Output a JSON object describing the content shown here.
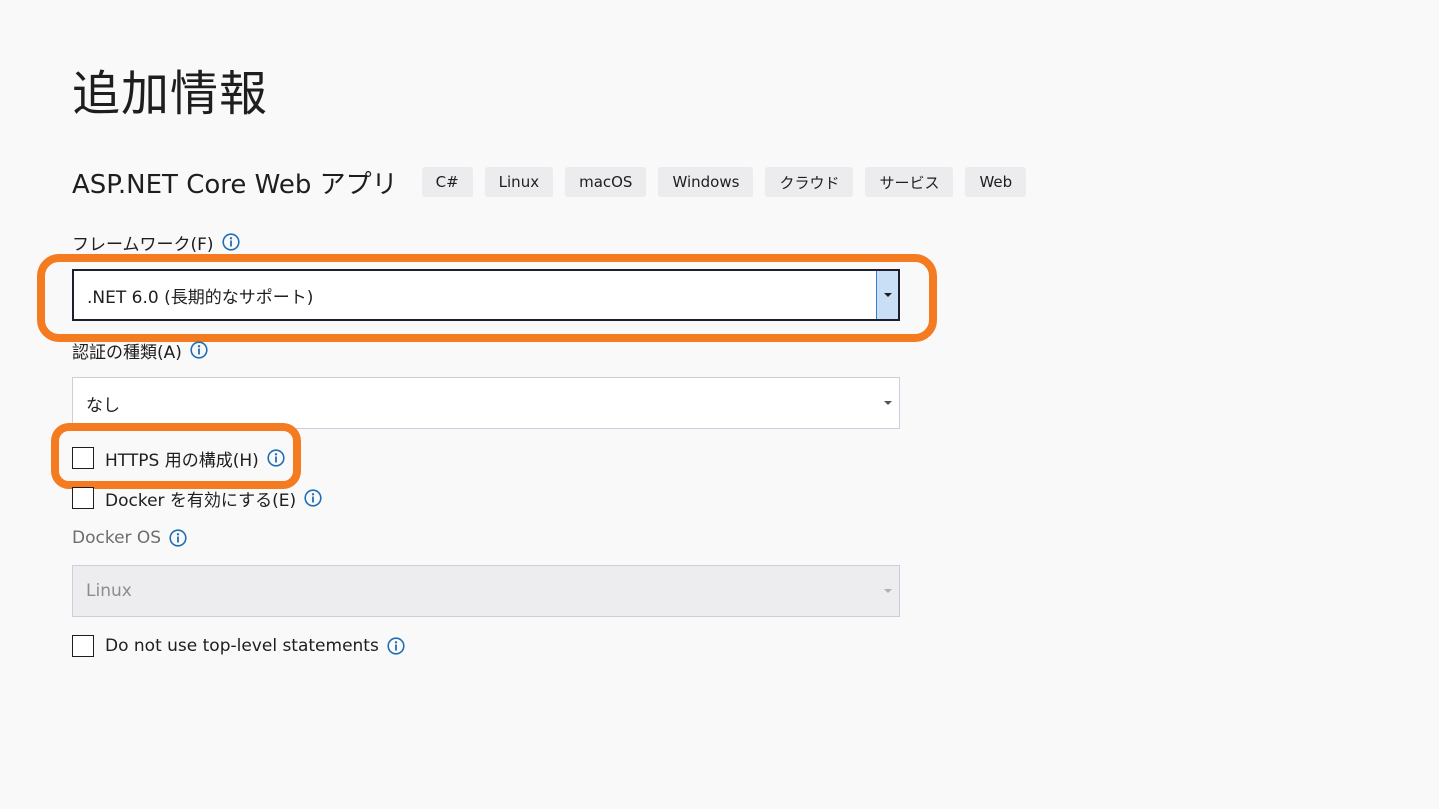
{
  "page": {
    "title": "追加情報"
  },
  "template": {
    "name": "ASP.NET Core Web アプリ",
    "tags": [
      "C#",
      "Linux",
      "macOS",
      "Windows",
      "クラウド",
      "サービス",
      "Web"
    ]
  },
  "framework": {
    "label": "フレームワーク(F)",
    "value": ".NET 6.0 (長期的なサポート)"
  },
  "auth": {
    "label": "認証の種類(A)",
    "value": "なし"
  },
  "https": {
    "label": "HTTPS 用の構成(H)",
    "checked": false
  },
  "docker": {
    "label": "Docker を有効にする(E)",
    "checked": false
  },
  "docker_os": {
    "label": "Docker OS",
    "value": "Linux",
    "disabled": true
  },
  "top_level": {
    "label": "Do not use top-level statements",
    "checked": false
  },
  "colors": {
    "highlight": "#f47b20",
    "info_icon": "#1f6fb5",
    "background": "#f9f9fa"
  }
}
